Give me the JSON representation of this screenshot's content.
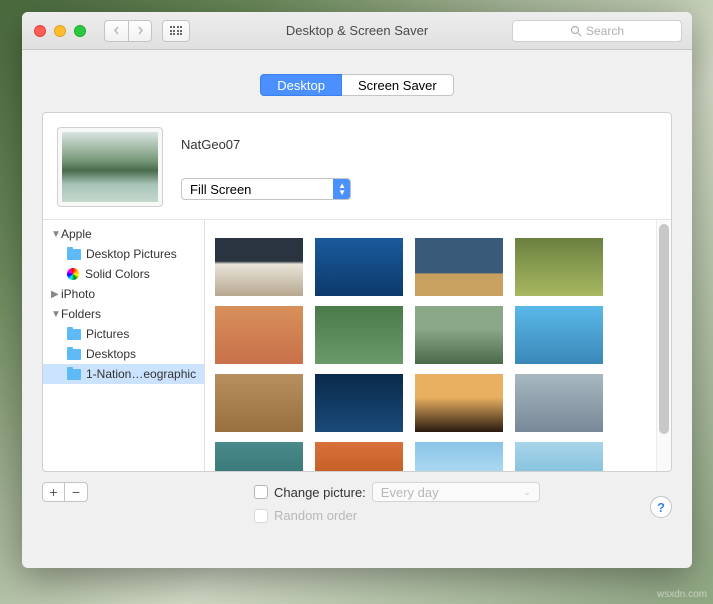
{
  "window": {
    "title": "Desktop & Screen Saver",
    "search_placeholder": "Search"
  },
  "tabs": [
    "Desktop",
    "Screen Saver"
  ],
  "active_tab": 0,
  "preview": {
    "name": "NatGeo07",
    "fill_mode": "Fill Screen"
  },
  "sidebar": {
    "groups": [
      {
        "label": "Apple",
        "expanded": true,
        "children": [
          {
            "label": "Desktop Pictures",
            "icon": "folder"
          },
          {
            "label": "Solid Colors",
            "icon": "color"
          }
        ]
      },
      {
        "label": "iPhoto",
        "expanded": false,
        "children": []
      },
      {
        "label": "Folders",
        "expanded": true,
        "children": [
          {
            "label": "Pictures",
            "icon": "folder"
          },
          {
            "label": "Desktops",
            "icon": "folder"
          },
          {
            "label": "1-Nation…eographic",
            "icon": "folder",
            "selected": true
          }
        ]
      }
    ]
  },
  "thumbnails": [
    {
      "bg": "linear-gradient(#2a3440 40%, #e8e4d8 45%, #b8a890 100%)"
    },
    {
      "bg": "linear-gradient(#1a5a9c, #0d3a6c)"
    },
    {
      "bg": "linear-gradient(#3a5a7a 60%, #c8a060 62%)"
    },
    {
      "bg": "linear-gradient(#6a8040, #a8b860)"
    },
    {
      "bg": "linear-gradient(#d8905a, #c8704a)"
    },
    {
      "bg": "linear-gradient(#4a7a4a, #6a9a6a)"
    },
    {
      "bg": "linear-gradient(#8aa888 40%, #4a6a4a 100%)"
    },
    {
      "bg": "linear-gradient(#5ab8e8, #3a88b8)"
    },
    {
      "bg": "linear-gradient(#b89060, #987040)"
    },
    {
      "bg": "linear-gradient(#0a2a4a, #1a4a7a)"
    },
    {
      "bg": "linear-gradient(#e8b060 40%, #2a1a10 100%)"
    },
    {
      "bg": "linear-gradient(#a8b8c0, #788898)"
    },
    {
      "bg": "linear-gradient(#4a8a8a, #2a6a6a)"
    },
    {
      "bg": "linear-gradient(#d8703a, #b8501a)"
    },
    {
      "bg": "linear-gradient(#8ac4e8, #caeaf8)"
    },
    {
      "bg": "linear-gradient(#a8d4e8, #6ab4d8)"
    },
    {
      "bg": "linear-gradient(#887060, #a89080)"
    }
  ],
  "controls": {
    "change_picture_label": "Change picture:",
    "change_picture_checked": false,
    "interval": "Every day",
    "random_order_label": "Random order",
    "random_order_enabled": false
  },
  "watermark": "wsxdn.com"
}
